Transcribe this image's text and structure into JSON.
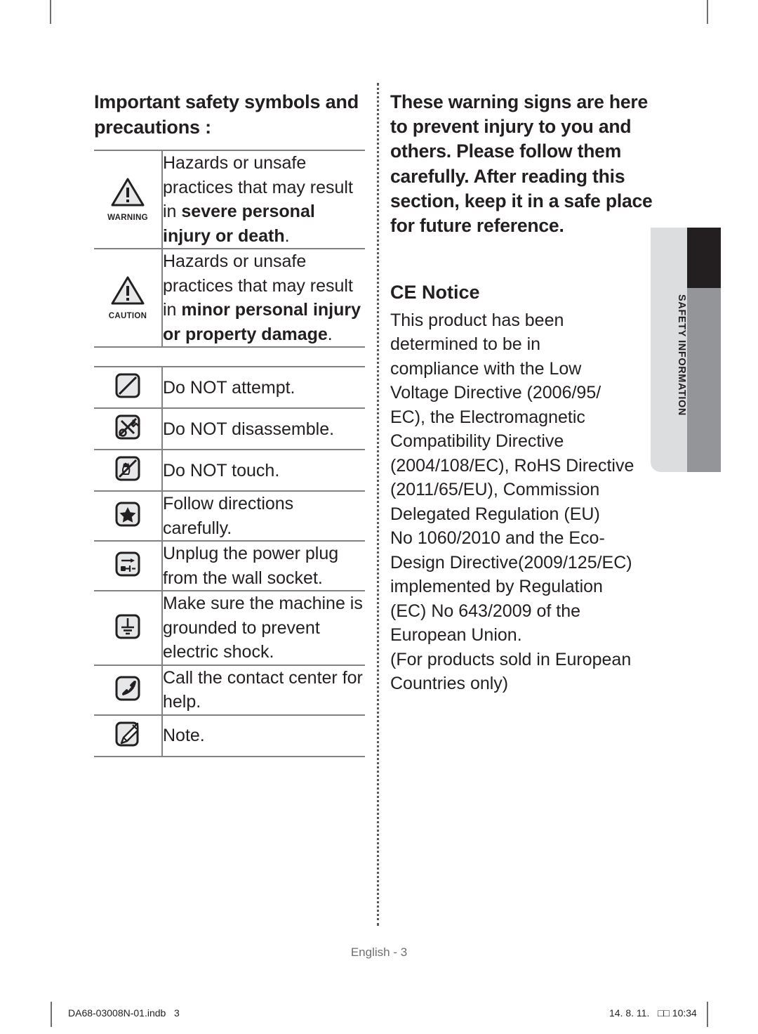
{
  "crop_marks": {
    "present": true
  },
  "left_column": {
    "heading": "Important safety symbols and precautions :",
    "severity_table": [
      {
        "icon": "warning-triangle-icon",
        "icon_label": "WARNING",
        "text_plain": "Hazards or unsafe practices that may result in ",
        "text_bold_1": "severe personal injury or death",
        "text_tail": "."
      },
      {
        "icon": "caution-triangle-icon",
        "icon_label": "CAUTION",
        "text_plain": "Hazards or unsafe practices that may result in ",
        "text_bold_1": "minor personal injury or property damage",
        "text_tail": "."
      }
    ],
    "symbol_table": [
      {
        "icon": "do-not-attempt-icon",
        "label": "Do NOT attempt."
      },
      {
        "icon": "do-not-disassemble-icon",
        "label": "Do NOT disassemble."
      },
      {
        "icon": "do-not-touch-icon",
        "label": "Do NOT touch."
      },
      {
        "icon": "follow-directions-star-icon",
        "label": "Follow directions carefully."
      },
      {
        "icon": "unplug-power-icon",
        "label": "Unplug the power plug from the wall socket."
      },
      {
        "icon": "grounding-icon",
        "label": "Make sure the machine is grounded to prevent electric shock."
      },
      {
        "icon": "phone-contact-icon",
        "label": "Call the contact center for help."
      },
      {
        "icon": "note-pencil-icon",
        "label": "Note."
      }
    ]
  },
  "right_column": {
    "heading": "These warning signs are here to prevent injury to you and others.\nPlease follow them carefully. After reading this section, keep it in a safe place for future reference.",
    "ce_title": "CE Notice",
    "ce_body_lines": [
      "This product has been",
      "determined to be in",
      "compliance with the Low",
      "Voltage Directive (2006/95/",
      "EC), the Electromagnetic",
      "Compatibility Directive",
      "(2004/108/EC), RoHS Directive",
      "(2011/65/EU), Commission",
      "Delegated Regulation (EU)",
      "No 1060/2010 and the Eco-",
      "Design Directive(2009/125/EC)",
      "implemented by Regulation",
      "(EC) No 643/2009 of the",
      "European Union.",
      "(For products sold in European",
      "Countries only)"
    ]
  },
  "side_tab": {
    "label": "SAFETY INFORMATION",
    "light_color": "#dcdddf",
    "dark_color": "#231f20",
    "grey_color": "#939598"
  },
  "footer": {
    "folio": "English - 3",
    "print_file": "DA68-03008N-01.indb   3",
    "print_timestamp": "14. 8. 11.   □□ 10:34"
  }
}
